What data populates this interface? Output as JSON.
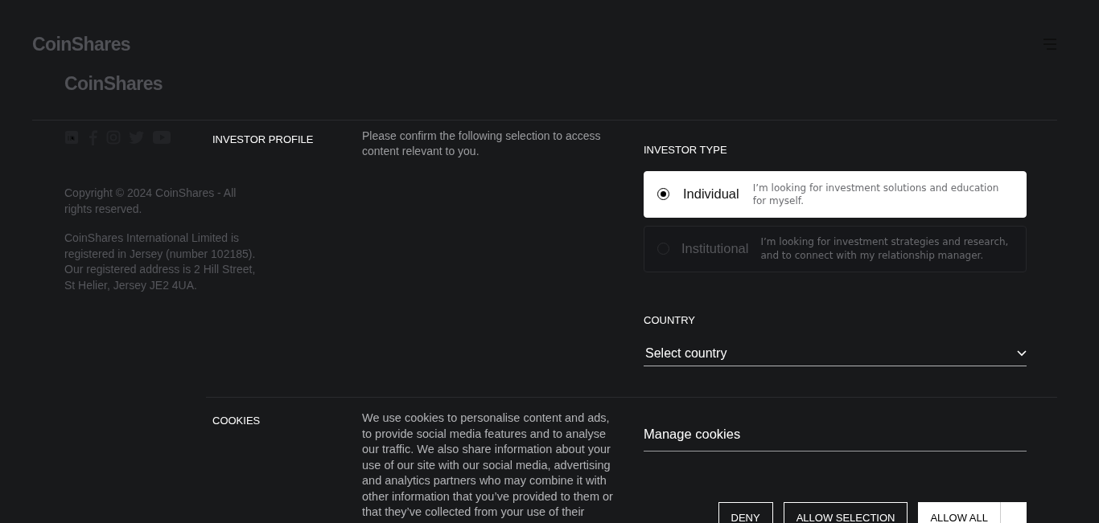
{
  "page": {
    "logo": "CoinShares",
    "footer_logo": "CoinShares",
    "copyright": "Copyright © 2024 CoinShares - All rights reserved.",
    "registration": "CoinShares International Limited is registered in Jersey (number 102185). Our registered address is 2 Hill Street, St Helier, Jersey JE2 4UA."
  },
  "investor_profile": {
    "heading": "INVESTOR PROFILE",
    "description": "Please confirm the following selection to access content relevant to you.",
    "type_label": "INVESTOR TYPE",
    "options": [
      {
        "label": "Individual",
        "description": "I’m looking for investment solutions and education for myself.",
        "selected": true
      },
      {
        "label": "Institutional",
        "description": "I’m looking for investment strategies and research, and to connect with my relationship manager.",
        "selected": false
      }
    ],
    "country_label": "COUNTRY",
    "country_placeholder": "Select country"
  },
  "cookies": {
    "heading": "COOKIES",
    "description": "We use cookies to personalise content and ads, to provide social media features and to analyse our traffic. We also share information about your use of our site with our social media, advertising and analytics partners who may combine it with other information that you’ve provided to them or that they’ve collected from your use of their",
    "manage_label": "Manage cookies",
    "buttons": [
      {
        "label": "DENY",
        "kind": "outline"
      },
      {
        "label": "ALLOW SELECTION",
        "kind": "outline"
      },
      {
        "label": "ALLOW ALL",
        "kind": "filled"
      }
    ]
  }
}
